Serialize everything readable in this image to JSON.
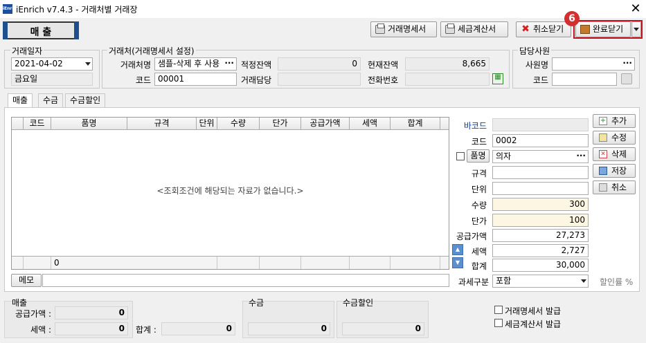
{
  "window": {
    "title": "iEnrich v7.4.3 - 거래처별 거래장",
    "app_icon": "iEnrich",
    "close_glyph": "✕"
  },
  "mode_tab": "매 출",
  "toolbar": {
    "statement_label": "거래명세서",
    "tax_invoice_label": "세금계산서",
    "cancel_close_label": "취소닫기",
    "done_close_label": "완료닫기",
    "step_badge": "6",
    "accent_color": "#c1121f"
  },
  "trade_date": {
    "group": "거래일자",
    "value": "2021-04-02",
    "weekday": "금요일"
  },
  "client": {
    "group": "거래처(거래명세서 설정)",
    "name_label": "거래처명",
    "name_value": "샘플-삭제 후 사용",
    "code_label": "코드",
    "code_value": "00001",
    "appropriate_balance_label": "적정잔액",
    "appropriate_balance_value": "0",
    "current_balance_label": "현재잔액",
    "current_balance_value": "8,665",
    "contact_label": "거래담당",
    "contact_value": "",
    "phone_label": "전화번호",
    "phone_value": ""
  },
  "staff": {
    "group": "담당사원",
    "name_label": "사원명",
    "name_value": "",
    "code_label": "코드",
    "code_value": ""
  },
  "tabs": [
    "매출",
    "수금",
    "수금할인"
  ],
  "grid": {
    "columns": [
      "코드",
      "품명",
      "규격",
      "단위",
      "수량",
      "단가",
      "공급가액",
      "세액",
      "합계"
    ],
    "empty_message": "<조회조건에 해당되는 자료가 없습니다.>",
    "footer_count": "0"
  },
  "memo_label": "메모",
  "item_form": {
    "barcode_label": "바코드",
    "barcode_value": "",
    "code_label": "코드",
    "code_value": "0002",
    "name_label": "품명",
    "name_value": "의자",
    "spec_label": "규격",
    "spec_value": "",
    "unit_label": "단위",
    "unit_value": "",
    "qty_label": "수량",
    "qty_value": "300",
    "price_label": "단가",
    "price_value": "100",
    "supply_label": "공급가액",
    "supply_value": "27,273",
    "tax_label": "세액",
    "tax_value": "2,727",
    "total_label": "합계",
    "total_value": "30,000",
    "tax_type_label": "과세구분",
    "tax_type_value": "포함",
    "discount_label": "할인률 %"
  },
  "side_buttons": {
    "add": "추가",
    "edit": "수정",
    "delete": "삭제",
    "save": "저장",
    "cancel": "취소"
  },
  "summary": {
    "sales_group": "매출",
    "supply_label": "공급가액 :",
    "supply_value": "0",
    "tax_label": "세액 :",
    "tax_value": "0",
    "total_label": "합계 :",
    "total_value": "0",
    "collection_group": "수금",
    "collection_value": "0",
    "collection_discount_group": "수금할인",
    "collection_discount_value": "0"
  },
  "checks": {
    "statement_issue": "거래명세서 발급",
    "tax_invoice_issue": "세금계산서 발급"
  }
}
